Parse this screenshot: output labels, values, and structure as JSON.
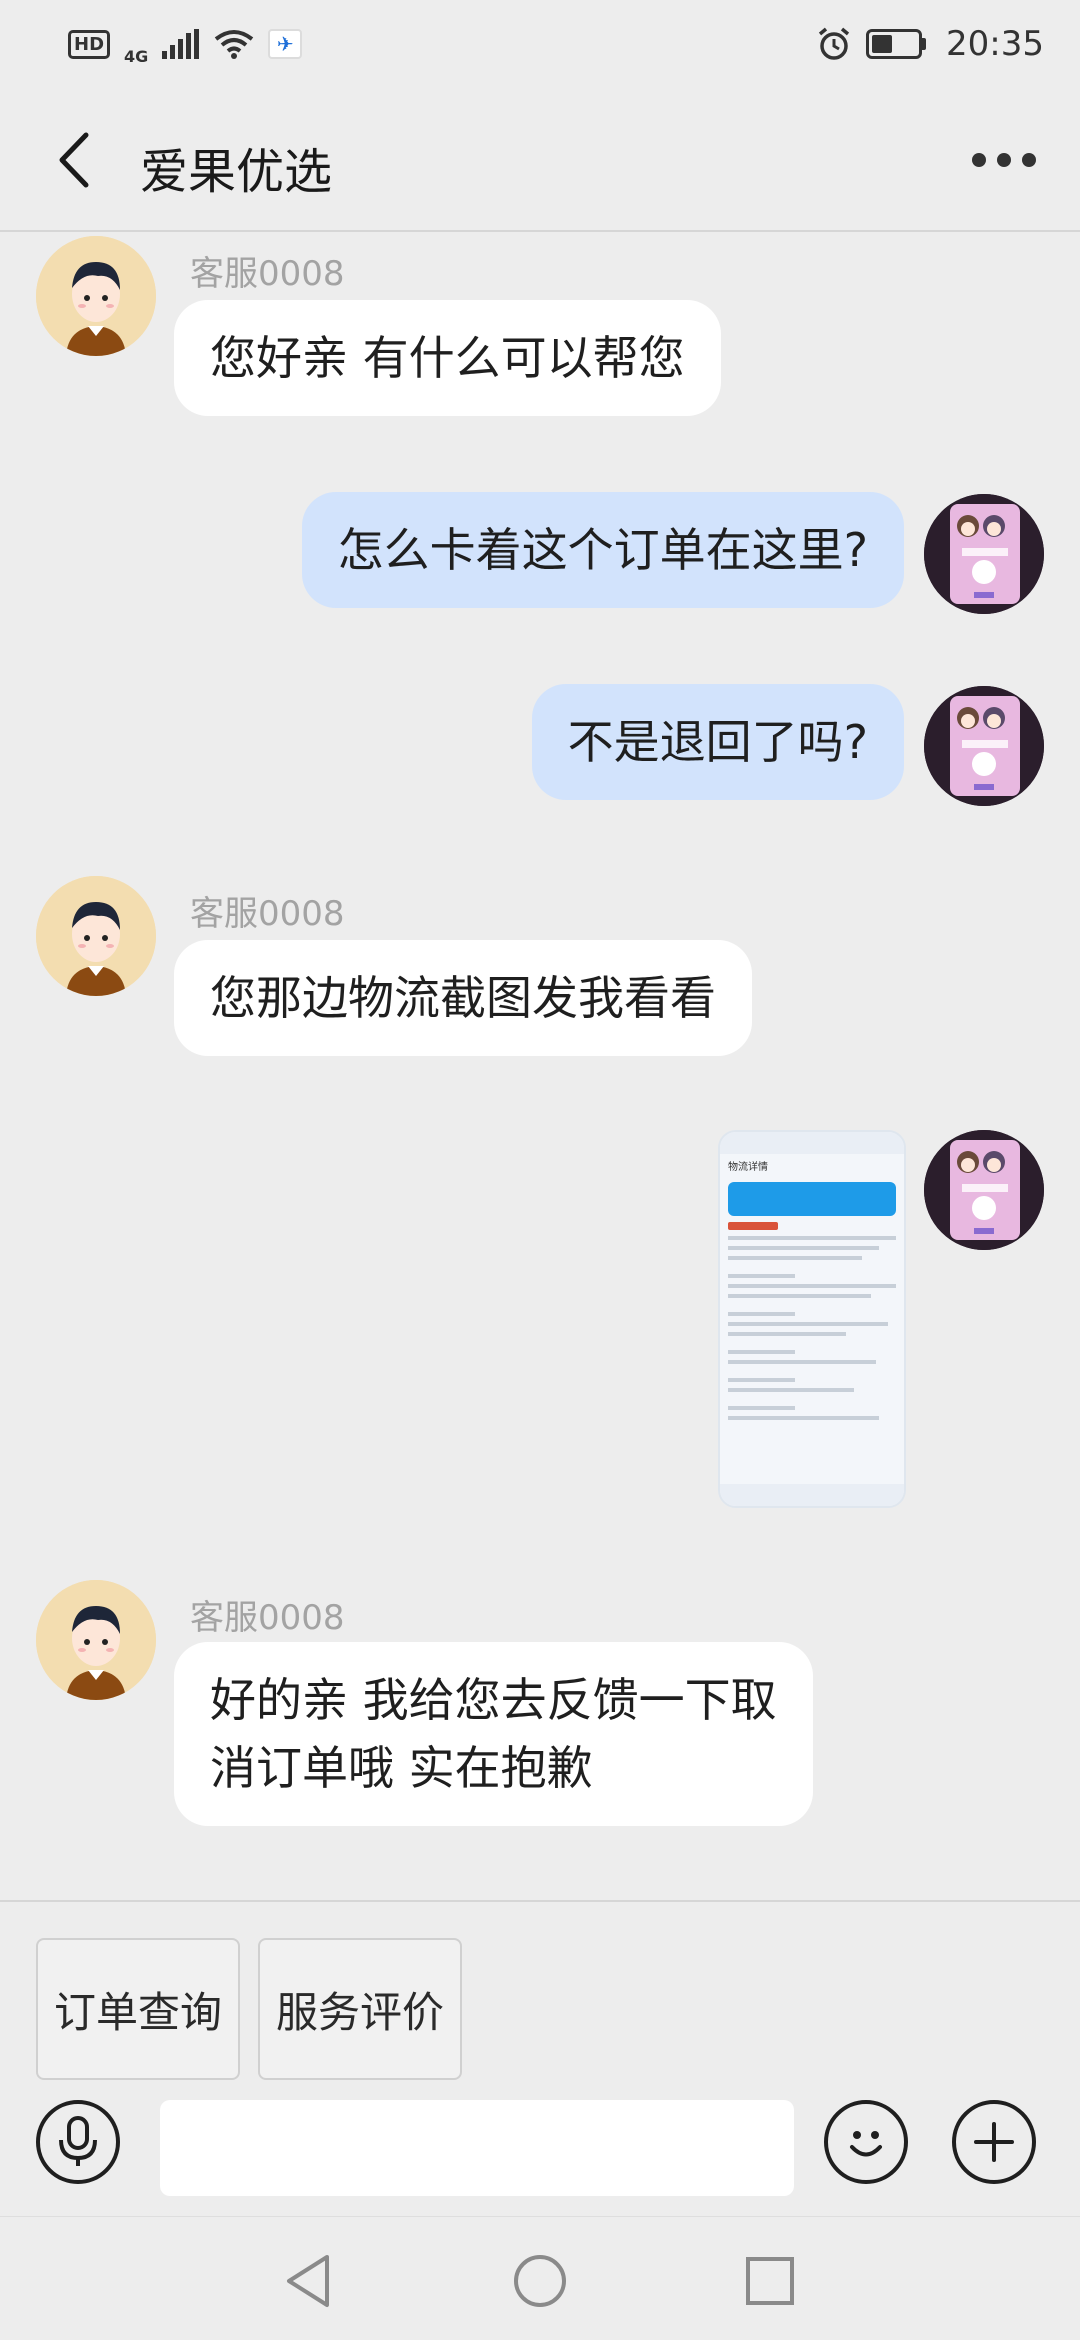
{
  "status_bar": {
    "hd": "HD",
    "network": "4G",
    "time": "20:35",
    "battery_level": 0.45,
    "icons": [
      "hd-icon",
      "signal-icon",
      "wifi-icon",
      "app-notification-icon",
      "alarm-icon",
      "battery-icon"
    ]
  },
  "header": {
    "title": "爱果优选",
    "back_icon": "chevron-left-icon",
    "more_icon": "more-dots-icon"
  },
  "messages": [
    {
      "side": "in",
      "sender": "客服0008",
      "text": "您好亲 有什么可以帮您"
    },
    {
      "side": "out",
      "text": "怎么卡着这个订单在这里?"
    },
    {
      "side": "out",
      "text": "不是退回了吗?"
    },
    {
      "side": "in",
      "sender": "客服0008",
      "text": "您那边物流截图发我看看"
    },
    {
      "side": "out",
      "type": "image",
      "text": "物流详情"
    },
    {
      "side": "in",
      "sender": "客服0008",
      "text": "好的亲 我给您去反馈一下取\n消订单哦 实在抱歉"
    }
  ],
  "quick_replies": [
    "订单查询",
    "服务评价"
  ],
  "input": {
    "placeholder": "",
    "value": ""
  },
  "input_icons": [
    "microphone-icon",
    "emoji-icon",
    "plus-icon"
  ],
  "system_nav": [
    "back-triangle-icon",
    "home-circle-icon",
    "recents-square-icon"
  ],
  "colors": {
    "background": "#ededed",
    "incoming_bubble": "#ffffff",
    "outgoing_bubble": "#d2e3fc",
    "sender_name": "#a3a3a3"
  }
}
